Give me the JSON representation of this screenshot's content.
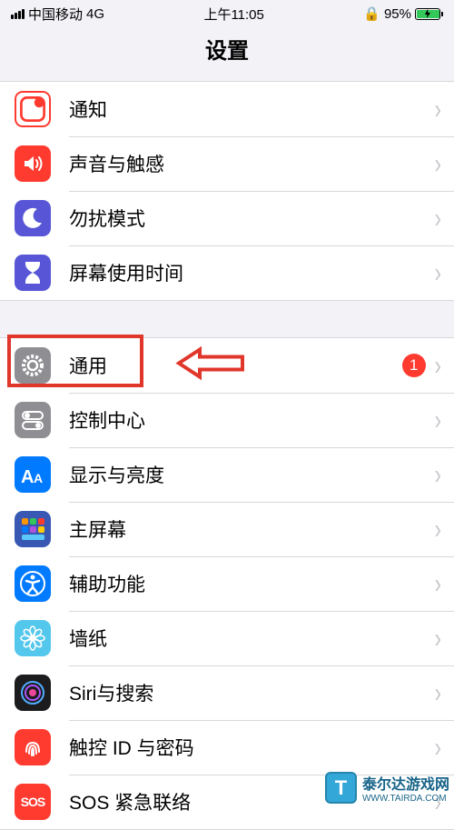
{
  "status": {
    "carrier": "中国移动",
    "network": "4G",
    "time": "上午11:05",
    "battery_pct": "95%"
  },
  "header": {
    "title": "设置"
  },
  "groups": [
    {
      "rows": [
        {
          "name": "notifications",
          "label": "通知",
          "icon_bg": "#ffffff",
          "icon_color": "#ff3b30",
          "icon": "notification"
        },
        {
          "name": "sounds",
          "label": "声音与触感",
          "icon_bg": "#ff3b30",
          "icon_color": "#ffffff",
          "icon": "sound"
        },
        {
          "name": "dnd",
          "label": "勿扰模式",
          "icon_bg": "#5856d6",
          "icon_color": "#ffffff",
          "icon": "moon"
        },
        {
          "name": "screentime",
          "label": "屏幕使用时间",
          "icon_bg": "#5856d6",
          "icon_color": "#ffffff",
          "icon": "hourglass"
        }
      ]
    },
    {
      "rows": [
        {
          "name": "general",
          "label": "通用",
          "icon_bg": "#8e8e93",
          "icon_color": "#ffffff",
          "icon": "gear",
          "badge": "1",
          "highlight": true
        },
        {
          "name": "control-center",
          "label": "控制中心",
          "icon_bg": "#8e8e93",
          "icon_color": "#ffffff",
          "icon": "switches"
        },
        {
          "name": "display",
          "label": "显示与亮度",
          "icon_bg": "#007aff",
          "icon_color": "#ffffff",
          "icon": "text-size"
        },
        {
          "name": "home-screen",
          "label": "主屏幕",
          "icon_bg": "#3858b3",
          "icon_color": "#ffffff",
          "icon": "grid"
        },
        {
          "name": "accessibility",
          "label": "辅助功能",
          "icon_bg": "#007aff",
          "icon_color": "#ffffff",
          "icon": "accessibility"
        },
        {
          "name": "wallpaper",
          "label": "墙纸",
          "icon_bg": "#54c7ec",
          "icon_color": "#ffffff",
          "icon": "flower"
        },
        {
          "name": "siri",
          "label": "Siri与搜索",
          "icon_bg": "#1c1c1e",
          "icon_color": "#ffffff",
          "icon": "siri"
        },
        {
          "name": "touchid",
          "label": "触控 ID 与密码",
          "icon_bg": "#ff3b30",
          "icon_color": "#ffffff",
          "icon": "fingerprint"
        },
        {
          "name": "sos",
          "label": "SOS 紧急联络",
          "icon_bg": "#ff3b30",
          "icon_color": "#ffffff",
          "icon": "sos"
        }
      ]
    }
  ],
  "watermark": {
    "logo": "T",
    "text": "泰尔达游戏网",
    "sub": "WWW.TAIRDA.COM"
  }
}
